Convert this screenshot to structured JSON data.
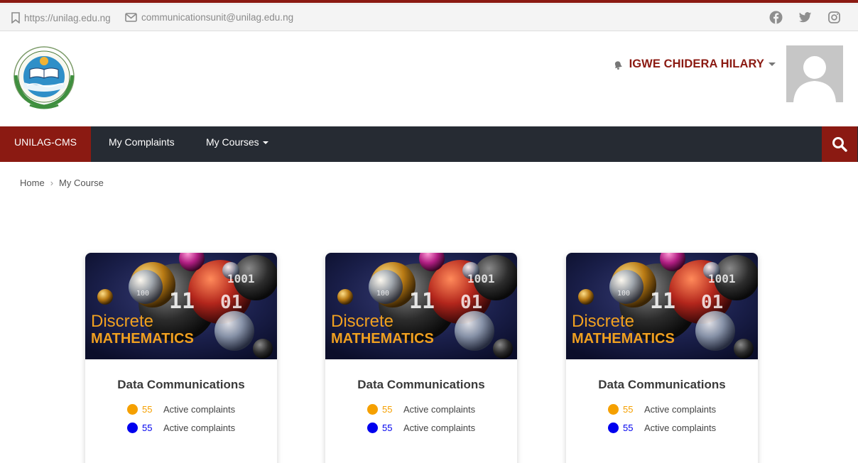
{
  "topbar": {
    "website": "https://unilag.edu.ng",
    "email": "communicationsunit@unilag.edu.ng",
    "socials": [
      "facebook-icon",
      "twitter-icon",
      "instagram-icon"
    ]
  },
  "header": {
    "logo_name": "UNIVERSITY OF LAGOS",
    "logo_motto": "IN DEED AND IN TRUTH",
    "user_name": "IGWE CHIDERA HILARY"
  },
  "nav": {
    "brand": "UNILAG-CMS",
    "items": [
      "My Complaints",
      "My Courses"
    ]
  },
  "breadcrumb": {
    "home": "Home",
    "current": "My Course"
  },
  "colors": {
    "brand": "#8b1a12",
    "nav_bg": "#262b33",
    "stat_orange": "#f5a000",
    "stat_blue": "#0000ee"
  },
  "cards": [
    {
      "banner_line1": "Discrete",
      "banner_line2": "MATHEMATICS",
      "title": "Data Communications",
      "stats": [
        {
          "count": "55",
          "label": "Active complaints",
          "color": "#f5a000"
        },
        {
          "count": "55",
          "label": "Active complaints",
          "color": "#0000ee"
        }
      ]
    },
    {
      "banner_line1": "Discrete",
      "banner_line2": "MATHEMATICS",
      "title": "Data Communications",
      "stats": [
        {
          "count": "55",
          "label": "Active complaints",
          "color": "#f5a000"
        },
        {
          "count": "55",
          "label": "Active complaints",
          "color": "#0000ee"
        }
      ]
    },
    {
      "banner_line1": "Discrete",
      "banner_line2": "MATHEMATICS",
      "title": "Data Communications",
      "stats": [
        {
          "count": "55",
          "label": "Active complaints",
          "color": "#f5a000"
        },
        {
          "count": "55",
          "label": "Active complaints",
          "color": "#0000ee"
        }
      ]
    }
  ]
}
